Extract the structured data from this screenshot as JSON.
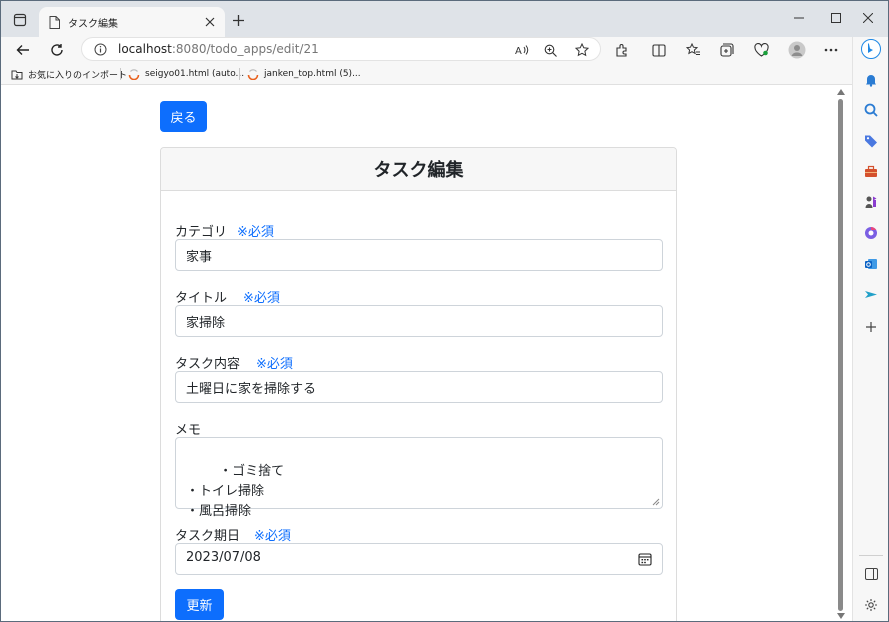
{
  "browser": {
    "tab_title": "タスク編集",
    "url_host": "localhost",
    "url_rest": ":8080/todo_apps/edit/21",
    "colors": {
      "accent": "#0d6efd",
      "tabstrip": "#dfe3e8"
    }
  },
  "bookmarks": [
    {
      "label": "お気に入りのインポート",
      "icon": "import-icon"
    },
    {
      "label": "seigyo01.html (auto...",
      "icon": "page-icon"
    },
    {
      "label": "janken_top.html (5)...",
      "icon": "page-icon"
    }
  ],
  "page": {
    "back_label": "戻る",
    "card_title": "タスク編集",
    "required_mark": "※必須",
    "fields": {
      "category": {
        "label": "カテゴリ",
        "value": "家事"
      },
      "title": {
        "label": "タイトル",
        "value": "家掃除"
      },
      "content": {
        "label": "タスク内容",
        "value": "土曜日に家を掃除する"
      },
      "memo": {
        "label": "メモ",
        "value": "・ゴミ捨て\n・トイレ掃除\n・風呂掃除"
      },
      "due": {
        "label": "タスク期日",
        "value": "2023/07/08"
      }
    },
    "submit_label": "更新"
  }
}
